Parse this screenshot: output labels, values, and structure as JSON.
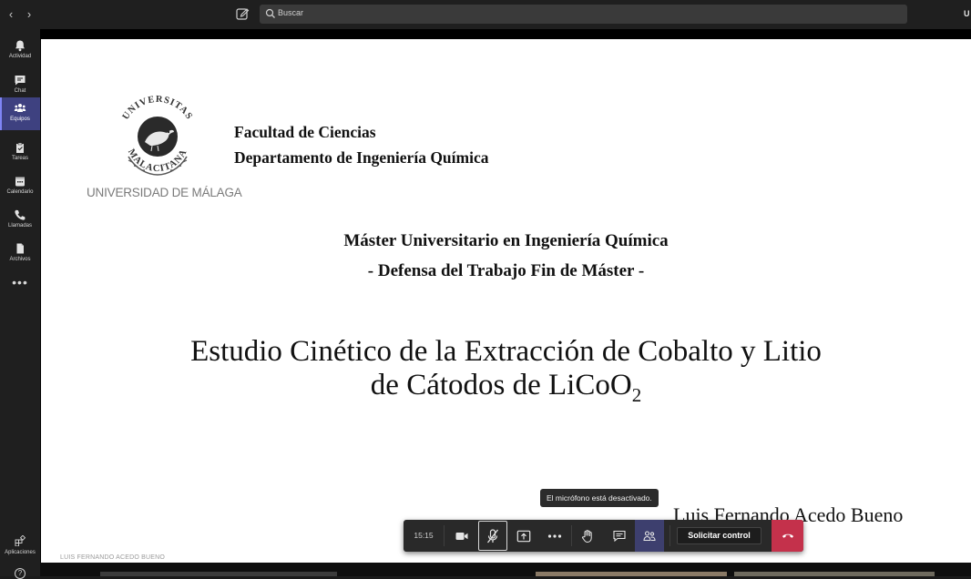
{
  "topbar": {
    "back_icon": "chevron-left-icon",
    "forward_icon": "chevron-right-icon",
    "compose_icon": "compose-icon",
    "search_placeholder": "Buscar",
    "user_initial": "U"
  },
  "rail": {
    "items": [
      {
        "label": "Actividad",
        "icon": "bell-icon"
      },
      {
        "label": "Chat",
        "icon": "chat-icon"
      },
      {
        "label": "Equipos",
        "icon": "teams-icon",
        "active": true
      },
      {
        "label": "Tareas",
        "icon": "tasks-icon"
      },
      {
        "label": "Calendario",
        "icon": "calendar-icon"
      },
      {
        "label": "Llamadas",
        "icon": "phone-icon"
      },
      {
        "label": "Archivos",
        "icon": "files-icon"
      }
    ],
    "more": "•••",
    "apps_label": "Aplicaciones",
    "help": "?"
  },
  "slide": {
    "university": "UNIVERSIDAD DE MÁLAGA",
    "seal_text_top": "UNIVERSITAS",
    "seal_text_bottom": "MALACITANA",
    "faculty": "Facultad de Ciencias",
    "department": "Departamento de Ingeniería Química",
    "master": "Máster Universitario en Ingeniería Química",
    "defense": "- Defensa del Trabajo Fin de Máster -",
    "title_line1": "Estudio Cinético de la Extracción de Cobalto y Litio",
    "title_line2": "de Cátodos de LiCoO",
    "title_sub": "2",
    "author": "Luis Fernando Acedo Bueno"
  },
  "tooltip": "El micrófono está desactivado.",
  "callbar": {
    "time": "15:15",
    "control_label": "Solicitar control",
    "accent": "#c4314b"
  },
  "presenter": "LUIS FERNANDO ACEDO BUENO"
}
